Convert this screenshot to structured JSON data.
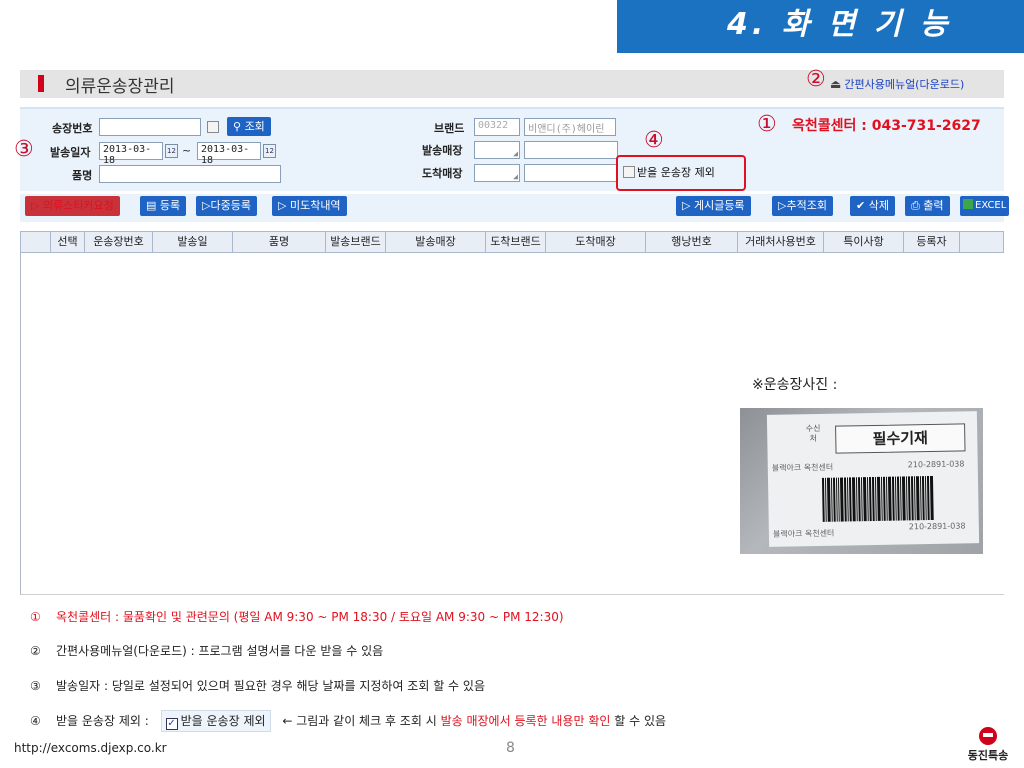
{
  "slide": {
    "title": "4. 화 면 기 능",
    "url": "http://excoms.djexp.co.kr",
    "page": "8",
    "logo_text": "동진특송"
  },
  "app": {
    "title": "의류운송장관리",
    "manual_link": "간편사용메뉴얼(다운로드)",
    "search": {
      "invoice_label": "송장번호",
      "search_button": "조회",
      "date_label": "발송일자",
      "date_from": "2013-03-18",
      "date_to": "2013-03-18",
      "tilde": "~",
      "item_label": "품명",
      "brand_label": "브랜드",
      "brand_code": "00322",
      "brand_name": "비앤디(주)헤이린",
      "send_store_label": "발송매장",
      "arrive_store_label": "도착매장",
      "exclude_label": "받을 운송장 제외"
    },
    "toolbar": {
      "sticker": "▷ 의류스티커요청",
      "register": "등록",
      "multi_register": "▷다중등록",
      "not_arrived": "▷ 미도착내역",
      "notice": "▷ 게시글등록",
      "track": "▷추적조회",
      "delete": "✔ 삭제",
      "print": "출력",
      "excel": "EXCEL"
    },
    "grid_columns": [
      "선택",
      "운송장번호",
      "발송일",
      "품명",
      "발송브랜드",
      "발송매장",
      "도착브랜드",
      "도착매장",
      "행낭번호",
      "거래처사용번호",
      "특이사항",
      "등록자"
    ]
  },
  "callouts": {
    "c1": "①",
    "c2": "②",
    "c3": "③",
    "c4": "④",
    "center": "옥천콜센터 : 043-731-2627"
  },
  "photo": {
    "caption": "※운송장사진 :",
    "required": "필수기재",
    "vert": "수신처",
    "line1_left": "블랙아크 옥천센터",
    "line1_right": "210-2891-038",
    "line2_left": "블랙아크 옥천센터",
    "line2_right": "210-2891-038"
  },
  "notes": [
    {
      "num": "①",
      "text": "옥천콜센터 : 물품확인 및 관련문의 (평일 AM 9:30 ~ PM 18:30 / 토요일 AM 9:30 ~ PM 12:30)"
    },
    {
      "num": "②",
      "text": "간편사용메뉴얼(다운로드) :  프로그램 설명서를 다운 받을 수 있음"
    },
    {
      "num": "③",
      "text": "발송일자 : 당일로 설정되어 있으며 필요한 경우 해당 날짜를 지정하여 조회 할 수 있음"
    },
    {
      "num": "④",
      "label": "받을 운송장 제외 :",
      "chk_label": "받을 운송장 제외",
      "arrow": "←  그림과 같이 체크 후 조회 시",
      "red_text": "발송 매장에서 등록한 내용만 확인",
      "tail": "할 수 있음"
    }
  ],
  "colors": {
    "accent": "#1b72c0",
    "button": "#1f64c4",
    "alert": "#e0101e"
  }
}
